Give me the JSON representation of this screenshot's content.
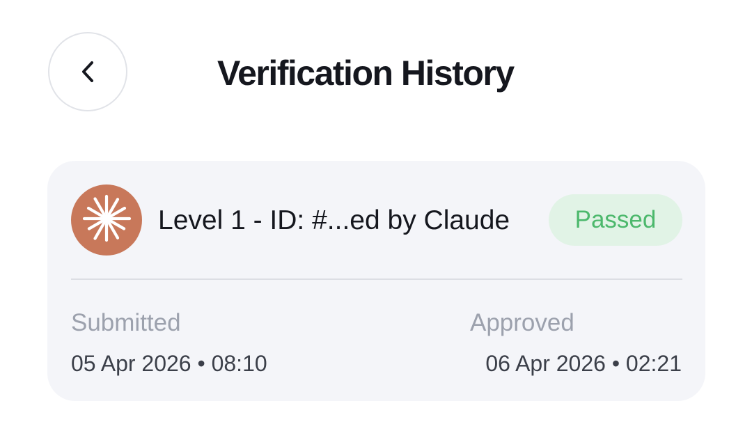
{
  "header": {
    "back_icon": "chevron-left-icon",
    "title": "Verification History"
  },
  "verification": {
    "avatar_icon": "sunburst-logo-icon",
    "avatar_color": "#c8785a",
    "title": "Level 1 - ID: #...ed by Claude",
    "status": "Passed",
    "status_color": "#4cb86c",
    "status_bg": "#e1f3e6",
    "submitted_label": "Submitted",
    "submitted_value": "05 Apr 2026 • 08:10",
    "approved_label": "Approved",
    "approved_value": "06 Apr 2026 • 02:21"
  }
}
